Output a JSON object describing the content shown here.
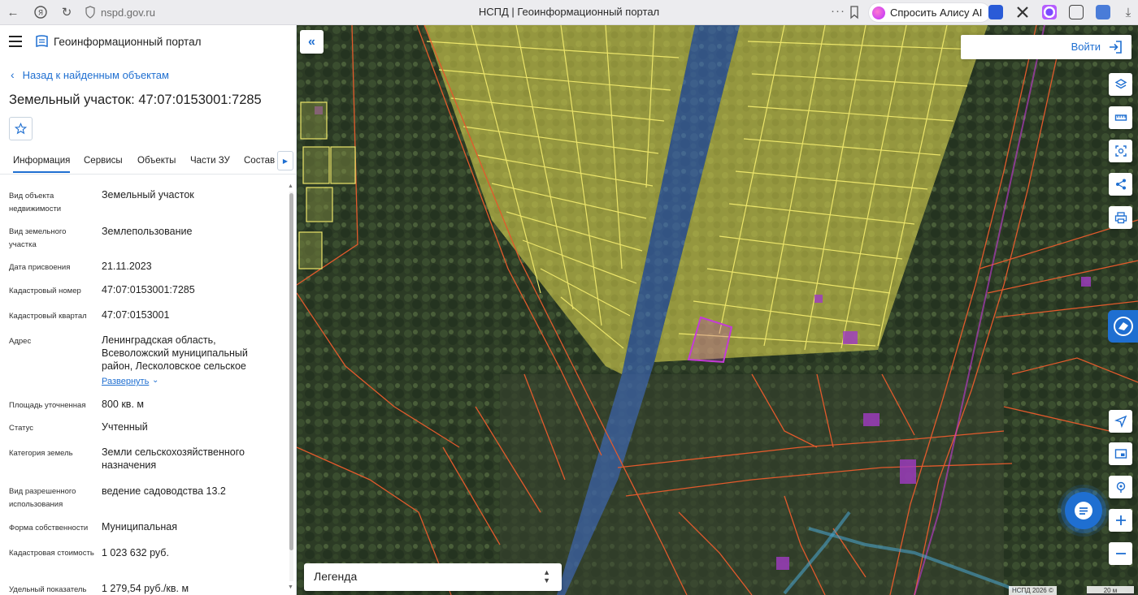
{
  "browser": {
    "url": "nspd.gov.ru",
    "page_title": "НСПД | Геоинформационный портал",
    "more_label": "···",
    "alice_label": "Спросить Алису AI"
  },
  "panel": {
    "portal_name": "Геоинформационный портал",
    "back_label": "Назад к найденным объектам",
    "title": "Земельный участок: 47:07:0153001:7285",
    "tabs": [
      "Информация",
      "Сервисы",
      "Объекты",
      "Части ЗУ",
      "Состав"
    ],
    "active_tab": "Информация",
    "expand_label": "Развернуть",
    "rows": [
      {
        "label": "Вид объекта недвижимости",
        "value": "Земельный участок"
      },
      {
        "label": "Вид земельного участка",
        "value": "Землепользование"
      },
      {
        "label": "Дата присвоения",
        "value": "21.11.2023"
      },
      {
        "label": "Кадастровый номер",
        "value": "47:07:0153001:7285"
      },
      {
        "label": "Кадастровый квартал",
        "value": "47:07:0153001"
      },
      {
        "label": "Адрес",
        "value": "Ленинградская область, Всеволожский муниципальный район, Лесколовское сельское"
      },
      {
        "label": "Площадь уточненная",
        "value": "800 кв. м"
      },
      {
        "label": "Статус",
        "value": "Учтенный"
      },
      {
        "label": "Категория земель",
        "value": "Земли сельскохозяйственного назначения"
      },
      {
        "label": "Вид разрешенного использования",
        "value": "ведение садоводства 13.2"
      },
      {
        "label": "Форма собственности",
        "value": "Муниципальная"
      },
      {
        "label": "Кадастровая стоимость",
        "value": "1 023 632 руб."
      },
      {
        "label": "Удельный показатель",
        "value": "1 279,54 руб./кв. м"
      }
    ]
  },
  "map": {
    "login_label": "Войти",
    "legend_label": "Легенда",
    "attribution": "НСПД 2026 ©",
    "scale_label": "20 м",
    "controls": [
      "layers-icon",
      "ruler-icon",
      "select-area-icon",
      "share-icon",
      "print-icon",
      "locate-icon",
      "minimap-icon",
      "geolocation-icon",
      "zoom-in-icon",
      "zoom-out-icon"
    ],
    "colors": {
      "accent": "#1f6fd1",
      "parcel_border": "#e25a2c",
      "garden_fill": "#c9c24a",
      "garden_border": "#ece56a",
      "water_fill": "#3f6fd6",
      "selected_border": "#c43bd6"
    }
  }
}
